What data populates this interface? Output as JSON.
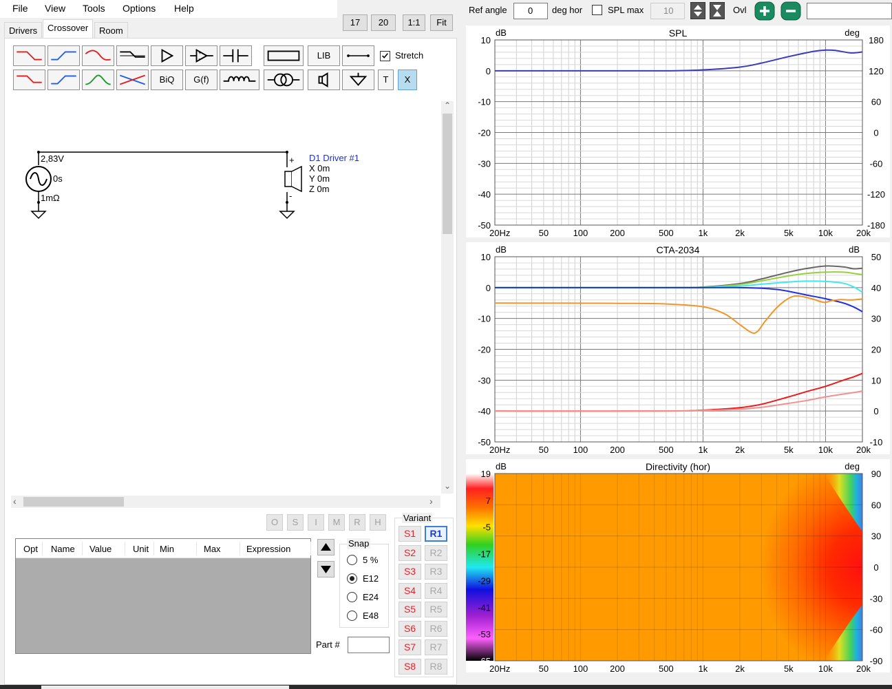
{
  "menu": [
    "File",
    "View",
    "Tools",
    "Options",
    "Help"
  ],
  "tabs": [
    "Drivers",
    "Crossover",
    "Room"
  ],
  "zoom_buttons": [
    "17",
    "20",
    "1:1",
    "Fit"
  ],
  "toolbar": {
    "lib": "LIB",
    "biq": "BiQ",
    "gf": "G(f)",
    "t": "T",
    "x": "X",
    "stretch_label": "Stretch",
    "stretch_checked": true
  },
  "schematic": {
    "source_voltage": "2,83V",
    "source_delay": "0s",
    "source_resistance": "1mΩ",
    "driver_name": "D1 Driver #1",
    "driver_x": "X 0m",
    "driver_y": "Y 0m",
    "driver_z": "Z 0m",
    "plus": "+",
    "minus": "-"
  },
  "param_buttons": [
    "O",
    "S",
    "I",
    "M",
    "R",
    "H"
  ],
  "param_table": {
    "columns": [
      "Opt",
      "Name",
      "Value",
      "Unit",
      "Min",
      "Max",
      "Expression"
    ]
  },
  "snap": {
    "title": "Snap",
    "options": [
      "5 %",
      "E12",
      "E24",
      "E48"
    ],
    "selected": "E12"
  },
  "part_label": "Part #",
  "variant": {
    "title": "Variant",
    "s": [
      "S1",
      "S2",
      "S3",
      "S4",
      "S5",
      "S6",
      "S7",
      "S8"
    ],
    "r": [
      "R1",
      "R2",
      "R3",
      "R4",
      "R5",
      "R6",
      "R7",
      "R8"
    ],
    "active": "R1"
  },
  "topbar": {
    "ref_angle_label": "Ref angle",
    "ref_angle_value": "0",
    "deg_hor": "deg hor",
    "spl_max_label": "SPL max",
    "spl_max_value": "10",
    "ovl": "Ovl"
  },
  "x_ticks": [
    "20Hz",
    "50",
    "100",
    "200",
    "500",
    "1k",
    "2k",
    "5k",
    "10k",
    "20k"
  ],
  "graphs": {
    "spl": {
      "title": "SPL",
      "left_unit": "dB",
      "right_unit": "deg",
      "left_ticks": [
        "10",
        "0",
        "-10",
        "-20",
        "-30",
        "-40",
        "-50"
      ],
      "right_ticks": [
        "180",
        "120",
        "60",
        "0",
        "-60",
        "-120",
        "-180"
      ]
    },
    "cta": {
      "title": "CTA-2034",
      "left_unit": "dB",
      "right_unit": "dB",
      "left_ticks": [
        "10",
        "0",
        "-10",
        "-20",
        "-30",
        "-40",
        "-50"
      ],
      "right_ticks": [
        "50",
        "40",
        "30",
        "20",
        "10",
        "0",
        "-10"
      ]
    },
    "directivity": {
      "title": "Directivity (hor)",
      "left_unit": "dB",
      "right_unit": "deg",
      "scale_ticks": [
        "19",
        "7",
        "-5",
        "-17",
        "-29",
        "-41",
        "-53",
        "-65"
      ],
      "right_ticks": [
        "90",
        "60",
        "30",
        "0",
        "-30",
        "-60",
        "-90"
      ]
    }
  },
  "chart_data": [
    {
      "type": "line",
      "title": "SPL",
      "x_scale": "log",
      "xlim": [
        20,
        20000
      ],
      "ylim": [
        -50,
        10
      ],
      "y2lim": [
        -180,
        180
      ],
      "grid": true,
      "series": [
        {
          "color": "#3b3bb8",
          "x": [
            20,
            100,
            500,
            1000,
            2000,
            3000,
            5000,
            8000,
            10000,
            12000,
            16000,
            20000
          ],
          "y": [
            0,
            0,
            0,
            0.3,
            1.2,
            2.5,
            4.6,
            6.3,
            6.7,
            6.6,
            5.8,
            6.1
          ]
        }
      ]
    },
    {
      "type": "line",
      "title": "CTA-2034",
      "x_scale": "log",
      "xlim": [
        20,
        20000
      ],
      "ylim": [
        -50,
        10
      ],
      "y2lim": [
        -10,
        50
      ],
      "grid": true,
      "series": [
        {
          "color": "#666666",
          "x": [
            20,
            500,
            1000,
            2000,
            3000,
            5000,
            7000,
            10000,
            14000,
            17000,
            20000
          ],
          "y": [
            0,
            0,
            0.2,
            1.3,
            2.8,
            5,
            6.2,
            7,
            6.7,
            6.1,
            6.3
          ]
        },
        {
          "color": "#96d040",
          "x": [
            20,
            500,
            1000,
            2000,
            3000,
            5000,
            7000,
            10000,
            14000,
            17000,
            20000
          ],
          "y": [
            0,
            0,
            0.1,
            1,
            2.2,
            3.8,
            4.6,
            5,
            5,
            4.6,
            4.2
          ]
        },
        {
          "color": "#40e8f0",
          "x": [
            20,
            500,
            1000,
            2000,
            3000,
            5000,
            7000,
            10000,
            14000,
            17000,
            20000
          ],
          "y": [
            0,
            0,
            0.05,
            0.5,
            1.1,
            1.8,
            2.1,
            2,
            1.4,
            0.2,
            -1.5
          ]
        },
        {
          "color": "#2030e0",
          "x": [
            20,
            1000,
            2000,
            3000,
            4000,
            5000,
            7000,
            10000,
            14000,
            17000,
            20000
          ],
          "y": [
            0,
            0,
            0,
            -0.2,
            -0.6,
            -1.2,
            -2.4,
            -3.6,
            -5,
            -6.3,
            -7.8
          ]
        },
        {
          "color": "#f0962a",
          "x": [
            20,
            200,
            500,
            1000,
            1500,
            2000,
            2500,
            2800,
            3200,
            4000,
            5000,
            6000,
            8000,
            9000,
            10000,
            11000,
            13000,
            16000,
            20000
          ],
          "y": [
            -5,
            -5.1,
            -5.3,
            -6.2,
            -8.5,
            -12,
            -14.6,
            -14.1,
            -11,
            -6.5,
            -3.5,
            -2.7,
            -3.8,
            -4.5,
            -4.8,
            -4.3,
            -3.9,
            -4,
            -3.7
          ]
        },
        {
          "color": "#ee1a1a",
          "x": [
            20,
            500,
            1000,
            2000,
            3000,
            5000,
            7000,
            10000,
            14000,
            17000,
            20000
          ],
          "y": [
            -40,
            -40,
            -39.7,
            -38.9,
            -37.8,
            -35.4,
            -33.7,
            -32,
            -30,
            -28.9,
            -27.8
          ]
        },
        {
          "color": "#f29090",
          "x": [
            20,
            500,
            1000,
            2000,
            3000,
            5000,
            7000,
            10000,
            14000,
            17000,
            20000
          ],
          "y": [
            -40,
            -40,
            -39.8,
            -39.4,
            -38.8,
            -37.5,
            -36.6,
            -35.4,
            -34.5,
            -34,
            -33.5
          ]
        }
      ]
    },
    {
      "type": "heatmap",
      "title": "Directivity (hor)",
      "x_scale": "log",
      "xlim": [
        20,
        20000
      ],
      "ylim": [
        -90,
        90
      ],
      "colorbar_range": [
        -65,
        19
      ]
    }
  ]
}
